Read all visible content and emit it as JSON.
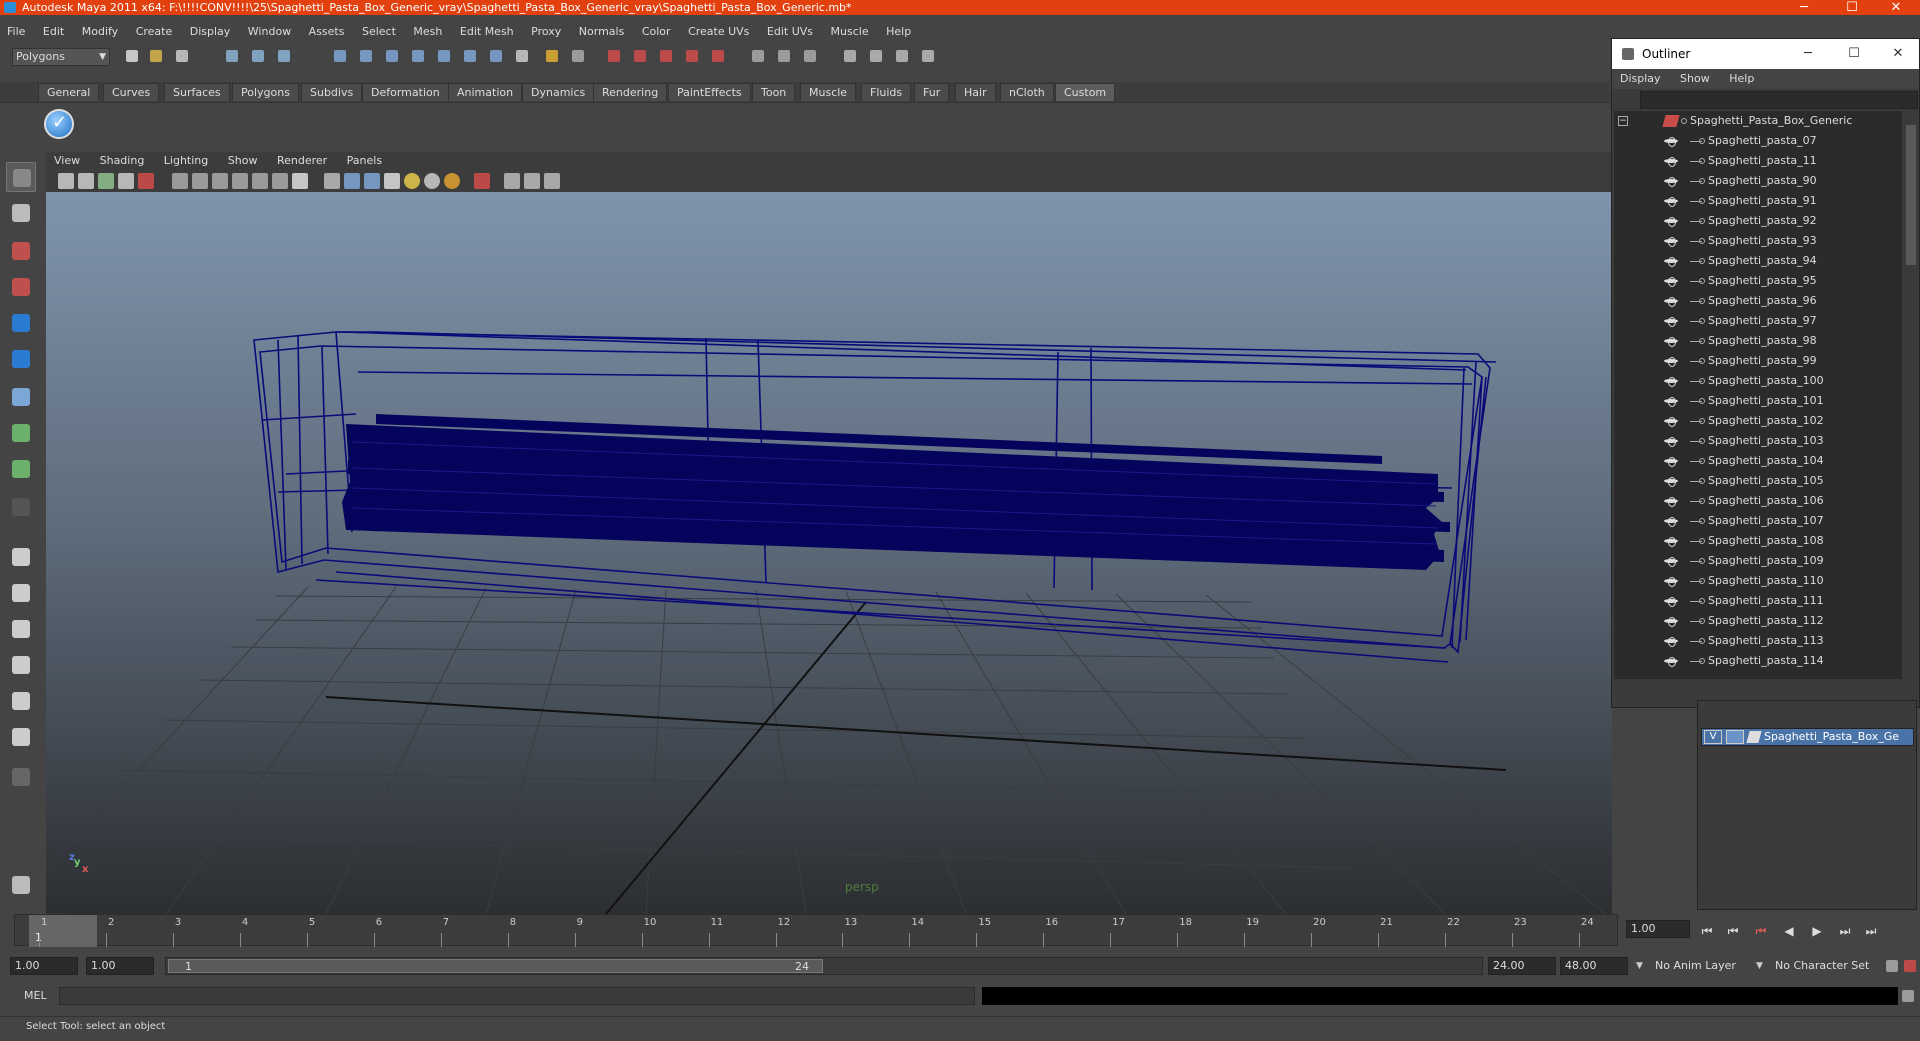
{
  "window": {
    "title": "Autodesk Maya 2011 x64: F:\\!!!!CONV!!!!\\25\\Spaghetti_Pasta_Box_Generic_vray\\Spaghetti_Pasta_Box_Generic_vray\\Spaghetti_Pasta_Box_Generic.mb*",
    "minimize": "─",
    "maximize": "☐",
    "close": "✕"
  },
  "menubar": [
    "File",
    "Edit",
    "Modify",
    "Create",
    "Display",
    "Window",
    "Assets",
    "Select",
    "Mesh",
    "Edit Mesh",
    "Proxy",
    "Normals",
    "Color",
    "Create UVs",
    "Edit UVs",
    "Muscle",
    "Help"
  ],
  "status_line": {
    "mode": "Polygons",
    "mode_arrow": "▼"
  },
  "shelf": {
    "tabs": [
      "General",
      "Curves",
      "Surfaces",
      "Polygons",
      "Subdivs",
      "Deformation",
      "Animation",
      "Dynamics",
      "Rendering",
      "PaintEffects",
      "Toon",
      "Muscle",
      "Fluids",
      "Fur",
      "Hair",
      "nCloth",
      "Custom"
    ],
    "active_tab": "Custom"
  },
  "viewport": {
    "menu": [
      "View",
      "Shading",
      "Lighting",
      "Show",
      "Renderer",
      "Panels"
    ],
    "camera_label": "persp",
    "axis": {
      "x": "x",
      "y": "y",
      "z": "z"
    },
    "wire_color": "#0a0a78",
    "bg_top": "#7f94ab",
    "bg_bottom": "#2c2e31"
  },
  "outliner": {
    "title": "Outliner",
    "menu": [
      "Display",
      "Show",
      "Help"
    ],
    "root": "Spaghetti_Pasta_Box_Generic",
    "expander": "−",
    "items": [
      "Spaghetti_pasta_07",
      "Spaghetti_pasta_11",
      "Spaghetti_pasta_90",
      "Spaghetti_pasta_91",
      "Spaghetti_pasta_92",
      "Spaghetti_pasta_93",
      "Spaghetti_pasta_94",
      "Spaghetti_pasta_95",
      "Spaghetti_pasta_96",
      "Spaghetti_pasta_97",
      "Spaghetti_pasta_98",
      "Spaghetti_pasta_99",
      "Spaghetti_pasta_100",
      "Spaghetti_pasta_101",
      "Spaghetti_pasta_102",
      "Spaghetti_pasta_103",
      "Spaghetti_pasta_104",
      "Spaghetti_pasta_105",
      "Spaghetti_pasta_106",
      "Spaghetti_pasta_107",
      "Spaghetti_pasta_108",
      "Spaghetti_pasta_109",
      "Spaghetti_pasta_110",
      "Spaghetti_pasta_111",
      "Spaghetti_pasta_112",
      "Spaghetti_pasta_113",
      "Spaghetti_pasta_114"
    ]
  },
  "layer_editor": {
    "layer": {
      "visible": "V",
      "name": "Spaghetti_Pasta_Box_Ge"
    }
  },
  "time_slider": {
    "ticks": [
      "1",
      "2",
      "3",
      "4",
      "5",
      "6",
      "7",
      "8",
      "9",
      "10",
      "11",
      "12",
      "13",
      "14",
      "15",
      "16",
      "17",
      "18",
      "19",
      "20",
      "21",
      "22",
      "23",
      "24"
    ],
    "current_frame": "1",
    "current_time_field": "1.00",
    "playback": [
      "⏮",
      "⏮",
      "⏮",
      "◀",
      "▶",
      "⏭",
      "⏭"
    ]
  },
  "range_slider": {
    "start_time": "1.00",
    "playback_start": "1.00",
    "range_start_label": "1",
    "range_end_label": "24",
    "playback_end": "24.00",
    "end_time": "48.00",
    "anim_layer": "No Anim Layer",
    "character_set": "No Character Set",
    "dropdown_arrow": "▼"
  },
  "command_line": {
    "label": "MEL"
  },
  "help_line": "Select Tool: select an object"
}
